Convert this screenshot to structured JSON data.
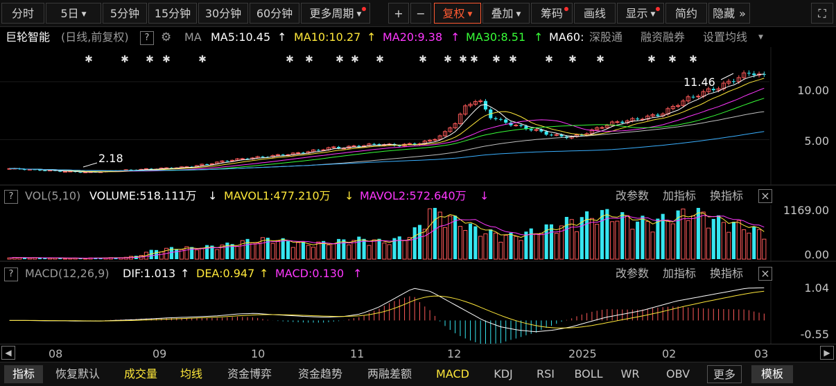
{
  "toolbar": {
    "items": [
      {
        "label": "分时",
        "dot": false,
        "caret": false,
        "active": false
      },
      {
        "label": "5日",
        "dot": false,
        "caret": true,
        "active": false
      },
      {
        "label": "5分钟",
        "dot": false,
        "caret": false,
        "active": false
      },
      {
        "label": "15分钟",
        "dot": false,
        "caret": false,
        "active": false
      },
      {
        "label": "30分钟",
        "dot": false,
        "caret": false,
        "active": false
      },
      {
        "label": "60分钟",
        "dot": false,
        "caret": false,
        "active": false
      },
      {
        "label": "更多周期",
        "dot": true,
        "caret": true,
        "active": false
      },
      {
        "label": "+",
        "dot": false,
        "caret": false,
        "active": false
      },
      {
        "label": "−",
        "dot": false,
        "caret": false,
        "active": false
      },
      {
        "label": "复权",
        "dot": false,
        "caret": true,
        "active": true
      },
      {
        "label": "叠加",
        "dot": false,
        "caret": true,
        "active": false
      },
      {
        "label": "筹码",
        "dot": true,
        "caret": false,
        "active": false
      },
      {
        "label": "画线",
        "dot": false,
        "caret": false,
        "active": false
      },
      {
        "label": "显示",
        "dot": true,
        "caret": true,
        "active": false
      },
      {
        "label": "简约",
        "dot": false,
        "caret": false,
        "active": false
      },
      {
        "label": "隐藏",
        "dot": false,
        "caret": false,
        "active": false
      }
    ],
    "hide_arrow": "»",
    "expand_icon": "fullscreen-icon"
  },
  "main_panel": {
    "stock_name": "巨轮智能",
    "mode": "(日线,前复权)",
    "help": "?",
    "ma_label": "MA",
    "ma5": "MA5:10.45",
    "ma10": "MA10:10.27",
    "ma20": "MA20:9.38",
    "ma30": "MA30:8.51",
    "ma60": "MA60:",
    "arrow_up": "↑",
    "link1": "深股通",
    "link2": "融资融券",
    "setting": "设置均线",
    "high_label": "11.46",
    "low_label": "2.18",
    "yticks": [
      "10.00",
      "5.00"
    ]
  },
  "vol_panel": {
    "help": "?",
    "title": "VOL(5,10)",
    "volume": "VOLUME:518.111万",
    "mavol1": "MAVOL1:477.210万",
    "mavol2": "MAVOL2:572.640万",
    "arrow_down": "↓",
    "btn1": "改参数",
    "btn2": "加指标",
    "btn3": "换指标",
    "close": "×",
    "yticks": [
      "1169.00",
      "0.00"
    ]
  },
  "macd_panel": {
    "help": "?",
    "title": "MACD(12,26,9)",
    "dif": "DIF:1.013",
    "dea": "DEA:0.947",
    "macd": "MACD:0.130",
    "arrow_up": "↑",
    "btn1": "改参数",
    "btn2": "加指标",
    "btn3": "换指标",
    "close": "×",
    "yticks": [
      "1.04",
      "-0.55"
    ]
  },
  "x_axis": {
    "left_arrow": "◀",
    "right_arrow": "▶",
    "labels": [
      "08",
      "09",
      "10",
      "11",
      "12",
      "2025",
      "02",
      "03"
    ]
  },
  "bottom_bar": {
    "items": [
      {
        "label": "指标",
        "style": "hl"
      },
      {
        "label": "恢复默认",
        "style": ""
      },
      {
        "label": "成交量",
        "style": "yel"
      },
      {
        "label": "均线",
        "style": "yel"
      },
      {
        "label": "资金博弈",
        "style": ""
      },
      {
        "label": "资金趋势",
        "style": ""
      },
      {
        "label": "两融差额",
        "style": ""
      },
      {
        "label": "MACD",
        "style": "yel"
      },
      {
        "label": "KDJ",
        "style": ""
      },
      {
        "label": "RSI",
        "style": ""
      },
      {
        "label": "BOLL",
        "style": ""
      },
      {
        "label": "WR",
        "style": ""
      },
      {
        "label": "OBV",
        "style": ""
      },
      {
        "label": "更多",
        "style": "box"
      },
      {
        "label": "模板",
        "style": "hl"
      }
    ]
  },
  "colors": {
    "up": "#ff5a5a",
    "down": "#36e6f0",
    "ma5": "#ffffff",
    "ma10": "#ffe83a",
    "ma20": "#ff38ff",
    "ma30": "#38ff38",
    "ma60": "#c0c0c0",
    "accent": "#ff5a32"
  },
  "chart_data": [
    {
      "type": "candlestick",
      "title": "巨轮智能 (日线,前复权)",
      "x_period_labels": [
        "08",
        "09",
        "10",
        "11",
        "12",
        "2025",
        "02",
        "03"
      ],
      "close_approx": [
        2.5,
        2.45,
        2.4,
        2.35,
        2.3,
        2.25,
        2.2,
        2.18,
        2.25,
        2.3,
        2.35,
        2.4,
        2.45,
        2.5,
        2.55,
        2.6,
        2.7,
        2.85,
        3.0,
        3.2,
        3.3,
        3.4,
        3.5,
        3.6,
        3.7,
        3.8,
        3.95,
        4.1,
        4.3,
        4.3,
        4.4,
        4.5,
        4.6,
        4.55,
        4.5,
        4.6,
        4.7,
        5.0,
        5.5,
        6.5,
        8.0,
        8.5,
        7.0,
        6.6,
        6.3,
        6.0,
        5.8,
        5.5,
        5.3,
        5.2,
        5.4,
        5.8,
        6.2,
        6.5,
        6.6,
        6.8,
        7.0,
        7.2,
        7.8,
        8.4,
        8.8,
        9.2,
        9.5,
        10.0,
        10.5,
        10.8,
        10.45
      ],
      "high_marker": 11.46,
      "low_marker": 2.18,
      "last_ma": {
        "MA5": 10.45,
        "MA10": 10.27,
        "MA20": 9.38,
        "MA30": 8.51
      },
      "ylim": [
        1.5,
        12.5
      ]
    },
    {
      "type": "bar",
      "title": "VOL(5,10)",
      "values_wan": [
        40,
        30,
        30,
        25,
        25,
        20,
        20,
        25,
        30,
        30,
        40,
        60,
        150,
        200,
        220,
        240,
        230,
        250,
        280,
        300,
        350,
        380,
        400,
        420,
        380,
        350,
        300,
        330,
        350,
        380,
        400,
        420,
        380,
        360,
        420,
        500,
        700,
        1169,
        900,
        800,
        700,
        600,
        550,
        500,
        480,
        520,
        600,
        650,
        700,
        800,
        850,
        900,
        950,
        900,
        850,
        800,
        780,
        820,
        900,
        950,
        1000,
        900,
        800,
        750,
        700,
        620,
        518
      ],
      "last": {
        "VOLUME": 518.111,
        "MAVOL1": 477.21,
        "MAVOL2": 572.64
      },
      "ylim": [
        0,
        1169
      ]
    },
    {
      "type": "line",
      "title": "MACD(12,26,9)",
      "dif_approx": [
        0.0,
        0.0,
        -0.01,
        -0.01,
        -0.02,
        -0.02,
        0.0,
        0.02,
        0.05,
        0.08,
        0.1,
        0.12,
        0.15,
        0.2,
        0.22,
        0.18,
        0.15,
        0.12,
        0.1,
        0.12,
        0.2,
        0.4,
        0.7,
        1.0,
        0.9,
        0.6,
        0.3,
        0.0,
        -0.2,
        -0.3,
        -0.35,
        -0.3,
        -0.2,
        -0.05,
        0.1,
        0.2,
        0.3,
        0.45,
        0.6,
        0.7,
        0.8,
        0.9,
        1.0,
        1.013
      ],
      "last": {
        "DIF": 1.013,
        "DEA": 0.947,
        "MACD": 0.13
      },
      "ylim": [
        -0.55,
        1.04
      ]
    }
  ]
}
